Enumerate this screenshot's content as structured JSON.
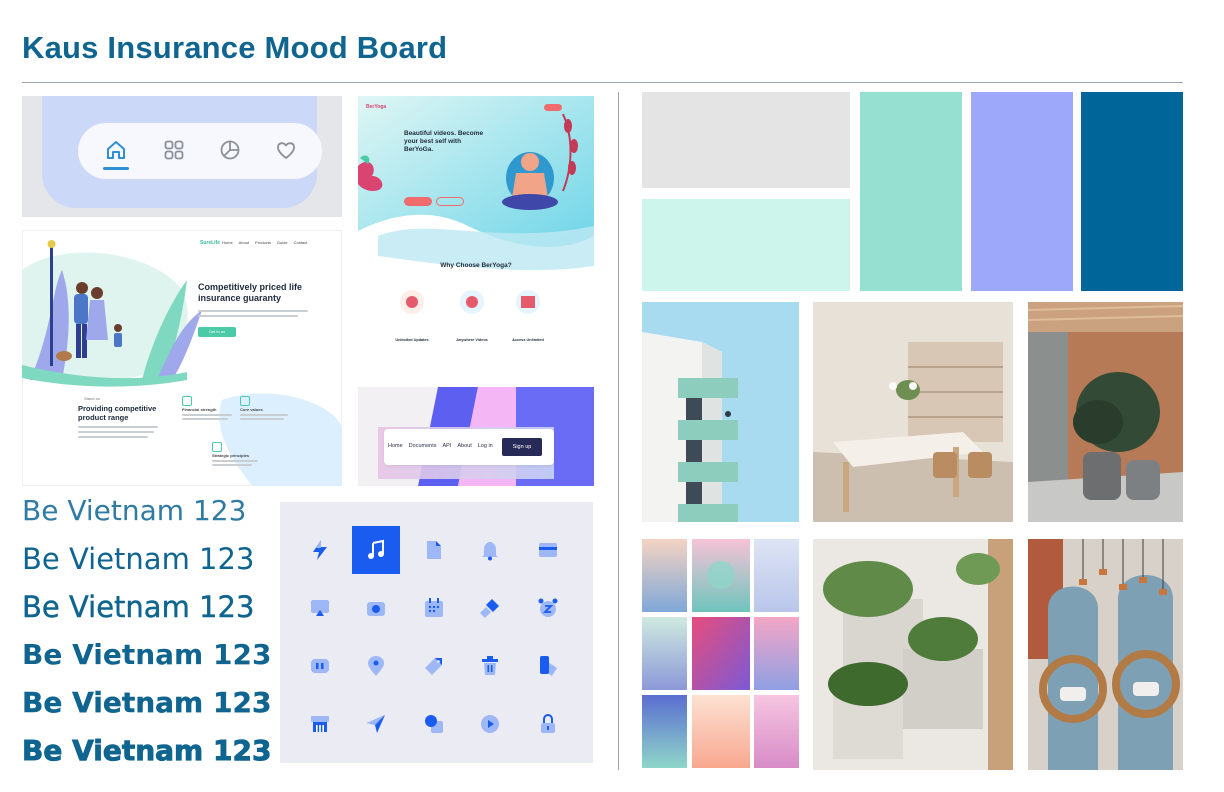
{
  "board": {
    "title": "Kaus Insurance Mood Board"
  },
  "insurance": {
    "logo": "SureLife",
    "nav": [
      "Home",
      "About",
      "Products",
      "Guide",
      "Contact"
    ],
    "headline": "Competitively priced life insurance guaranty",
    "cta": "Get to us",
    "feature_label": "Stand on",
    "feature_title": "Providing competitive product range",
    "items": [
      "Financial strength",
      "Core values",
      "Strategic principles"
    ]
  },
  "yoga": {
    "logo": "BerYoga",
    "headline": "Beautiful videos. Become your best self with BerYoGa.",
    "section": "Why Choose BerYoga?",
    "features": [
      "Unlimited Updates",
      "Anywhere Videos",
      "Access Unlimited"
    ]
  },
  "docs": {
    "nav": [
      "Home",
      "Documents",
      "API",
      "About",
      "Log in"
    ],
    "signup": "Sign up"
  },
  "font_samples": [
    "Be Vietnam 123",
    "Be Vietnam 123",
    "Be Vietnam 123",
    "Be Vietnam 123",
    "Be Vietnam 123",
    "Be Vietnam 123"
  ],
  "palette": [
    "#e4e4e4",
    "#cef5ec",
    "#96e0d2",
    "#9da8fb",
    "#006699"
  ],
  "icons": [
    "flash-icon",
    "music-icon",
    "document-icon",
    "bell-icon",
    "card-icon",
    "cast-icon",
    "camera-icon",
    "calendar-icon",
    "brush-icon",
    "alarm-icon",
    "battery-icon",
    "location-icon",
    "tag-icon",
    "trash-icon",
    "device-icon",
    "shop-icon",
    "send-icon",
    "shapes-icon",
    "play-icon",
    "lock-icon"
  ],
  "nav_icons": [
    "home-icon",
    "grid-icon",
    "pie-chart-icon",
    "heart-icon"
  ],
  "photos": [
    "building-photo",
    "office-photo",
    "plants-corridor-photo",
    "gradient-cards-photo",
    "wall-plants-photo",
    "arch-chairs-photo"
  ]
}
